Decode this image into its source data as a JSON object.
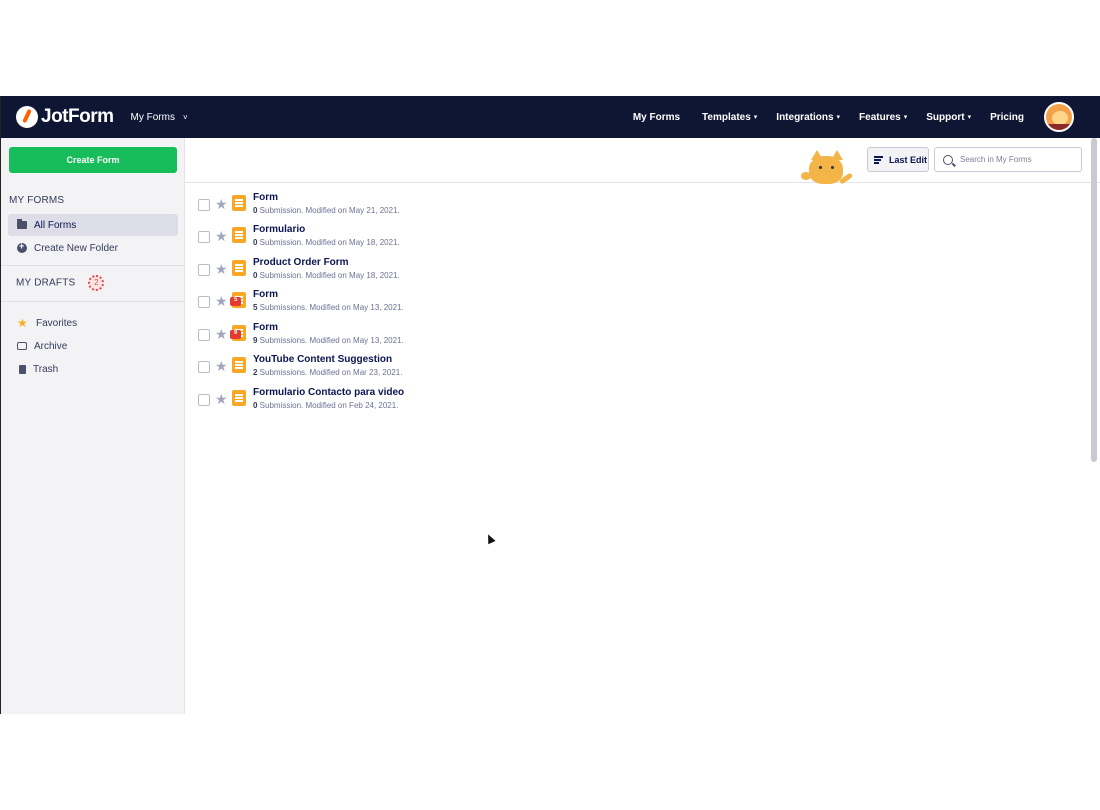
{
  "header": {
    "logo_text": "JotForm",
    "section_switch": "My Forms",
    "nav": [
      {
        "label": "My Forms",
        "caret": ""
      },
      {
        "label": "Templates",
        "caret": "▾"
      },
      {
        "label": "Integrations",
        "caret": "▾"
      },
      {
        "label": "Features",
        "caret": "▾"
      },
      {
        "label": "Support",
        "caret": "▾"
      },
      {
        "label": "Pricing",
        "caret": ""
      }
    ]
  },
  "sidebar": {
    "create_button": "Create Form",
    "my_forms_title": "MY FORMS",
    "all_forms": "All Forms",
    "create_folder": "Create New Folder",
    "my_drafts_title": "MY DRAFTS",
    "drafts_count": "2",
    "favorites": "Favorites",
    "archive": "Archive",
    "trash": "Trash"
  },
  "toolbar": {
    "sort_label": "Last Edit",
    "search_placeholder": "Search in My Forms"
  },
  "forms": [
    {
      "title": "Form",
      "count": "0",
      "meta": " Submission. Modified on May 21, 2021.",
      "badge": ""
    },
    {
      "title": "Formulario",
      "count": "0",
      "meta": " Submission. Modified on May 18, 2021.",
      "badge": ""
    },
    {
      "title": "Product Order Form",
      "count": "0",
      "meta": " Submission. Modified on May 18, 2021.",
      "badge": ""
    },
    {
      "title": "Form",
      "count": "5",
      "meta": " Submissions. Modified on May 13, 2021.",
      "badge": "5"
    },
    {
      "title": "Form",
      "count": "9",
      "meta": " Submissions. Modified on May 13, 2021.",
      "badge": "9"
    },
    {
      "title": "YouTube Content Suggestion",
      "count": "2",
      "meta": " Submissions. Modified on Mar 23, 2021.",
      "badge": ""
    },
    {
      "title": "Formulario Contacto para video",
      "count": "0",
      "meta": " Submission. Modified on Feb 24, 2021.",
      "badge": ""
    }
  ],
  "colors": {
    "nav_bg": "#0f1634",
    "create_button": "#18bd5b",
    "form_icon": "#f9a825",
    "favorite_star": "#f3b122"
  }
}
